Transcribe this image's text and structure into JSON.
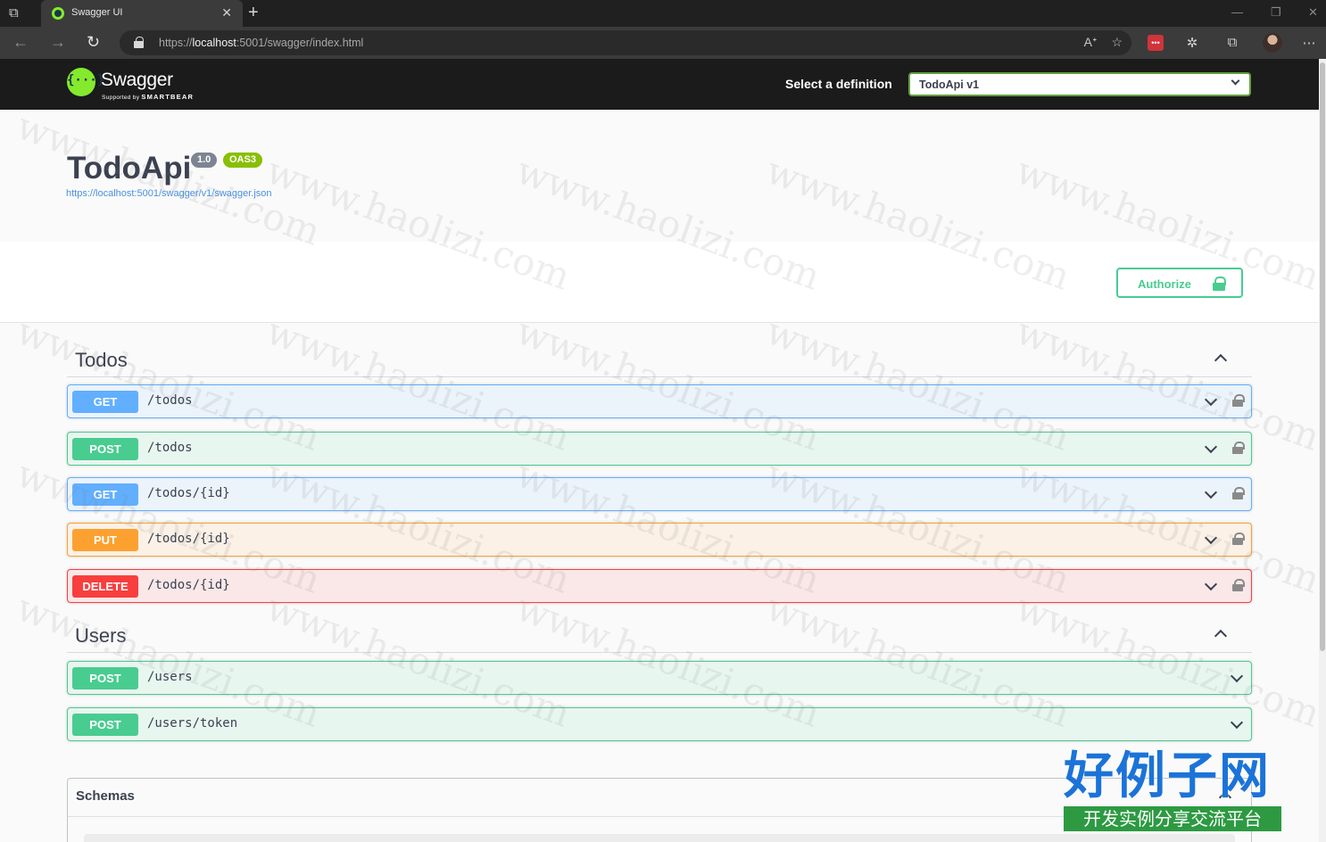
{
  "browser": {
    "tab_title": "Swagger UI",
    "url_prefix": "https://",
    "url_host": "localhost",
    "url_rest": ":5001/swagger/index.html"
  },
  "swagger": {
    "logo_text": "Swagger",
    "logo_sub_prefix": "Supported by",
    "logo_sub_brand": "SMARTBEAR",
    "definition_label": "Select a definition",
    "definition_value": "TodoApi v1"
  },
  "info": {
    "title": "TodoApi",
    "version": "1.0",
    "oas": "OAS3",
    "spec_url": "https://localhost:5001/swagger/v1/swagger.json"
  },
  "authorize_label": "Authorize",
  "tags": [
    {
      "name": "Todos",
      "operations": [
        {
          "method": "GET",
          "path": "/todos"
        },
        {
          "method": "POST",
          "path": "/todos"
        },
        {
          "method": "GET",
          "path": "/todos/{id}"
        },
        {
          "method": "PUT",
          "path": "/todos/{id}"
        },
        {
          "method": "DELETE",
          "path": "/todos/{id}"
        }
      ]
    },
    {
      "name": "Users",
      "operations": [
        {
          "method": "POST",
          "path": "/users"
        },
        {
          "method": "POST",
          "path": "/users/token"
        }
      ]
    }
  ],
  "schemas_label": "Schemas",
  "watermark": {
    "text": "www.haolizi.com",
    "brand_main": "好例子网",
    "brand_sub": "开发实例分享交流平台"
  },
  "colors": {
    "get": "#61affe",
    "post": "#49cc90",
    "put": "#fca130",
    "delete": "#f93e3e",
    "swagger_green": "#85ea2d"
  }
}
